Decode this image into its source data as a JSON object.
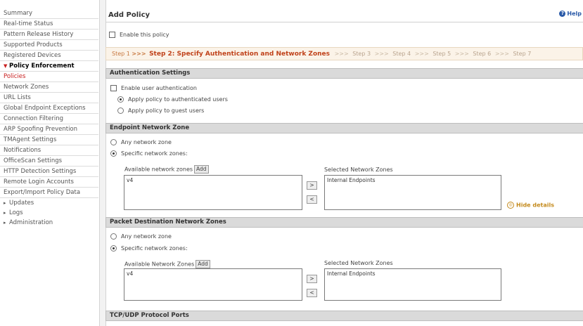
{
  "sidebar": {
    "items": [
      {
        "label": "Summary"
      },
      {
        "label": "Real-time Status"
      },
      {
        "label": "Pattern Release History"
      },
      {
        "label": "Supported Products"
      },
      {
        "label": "Registered Devices"
      },
      {
        "label": "Policy Enforcement"
      },
      {
        "label": "Policies"
      },
      {
        "label": "Network Zones"
      },
      {
        "label": "URL Lists"
      },
      {
        "label": "Global Endpoint Exceptions"
      },
      {
        "label": "Connection Filtering"
      },
      {
        "label": "ARP Spoofing Prevention"
      },
      {
        "label": "TMAgent Settings"
      },
      {
        "label": "Notifications"
      },
      {
        "label": "OfficeScan Settings"
      },
      {
        "label": "HTTP Detection Settings"
      },
      {
        "label": "Remote Login Accounts"
      },
      {
        "label": "Export/Import Policy Data"
      },
      {
        "label": "Updates"
      },
      {
        "label": "Logs"
      },
      {
        "label": "Administration"
      }
    ]
  },
  "header": {
    "title": "Add Policy",
    "help": "Help"
  },
  "enable_policy": {
    "label": "Enable this policy"
  },
  "steps": {
    "step1": "Step 1",
    "step2": "Step 2: Specify Authentication and Network Zones",
    "step3": "Step 3",
    "step4": "Step 4",
    "step5": "Step 5",
    "step6": "Step 6",
    "step7": "Step 7",
    "sep": ">>>"
  },
  "auth": {
    "title": "Authentication Settings",
    "enable_label": "Enable user authentication",
    "opt_authenticated": "Apply policy to authenticated users",
    "opt_guest": "Apply policy to guest users"
  },
  "endpoint_zone": {
    "title": "Endpoint Network Zone",
    "any": "Any network zone",
    "specific": "Specific network zones:",
    "available_label": "Available network zones",
    "add": "Add",
    "available_items": [
      "v4"
    ],
    "selected_label": "Selected Network Zones",
    "selected_items": [
      "Internal Endpoints"
    ],
    "move_right": ">",
    "move_left": "<",
    "hide_details": "Hide details"
  },
  "packet_zone": {
    "title": "Packet Destination Network Zones",
    "any": "Any network zone",
    "specific": "Specific network zones:",
    "available_label": "Available Network Zones",
    "add": "Add",
    "available_items": [
      "v4"
    ],
    "selected_label": "Selected Network Zones",
    "selected_items": [
      "Internal Endpoints"
    ],
    "move_right": ">",
    "move_left": "<"
  },
  "ports": {
    "title": "TCP/UDP Protocol Ports"
  },
  "colors": {
    "accent": "#c0421a",
    "link": "#2a5aa8",
    "section_bg": "#dadada"
  }
}
